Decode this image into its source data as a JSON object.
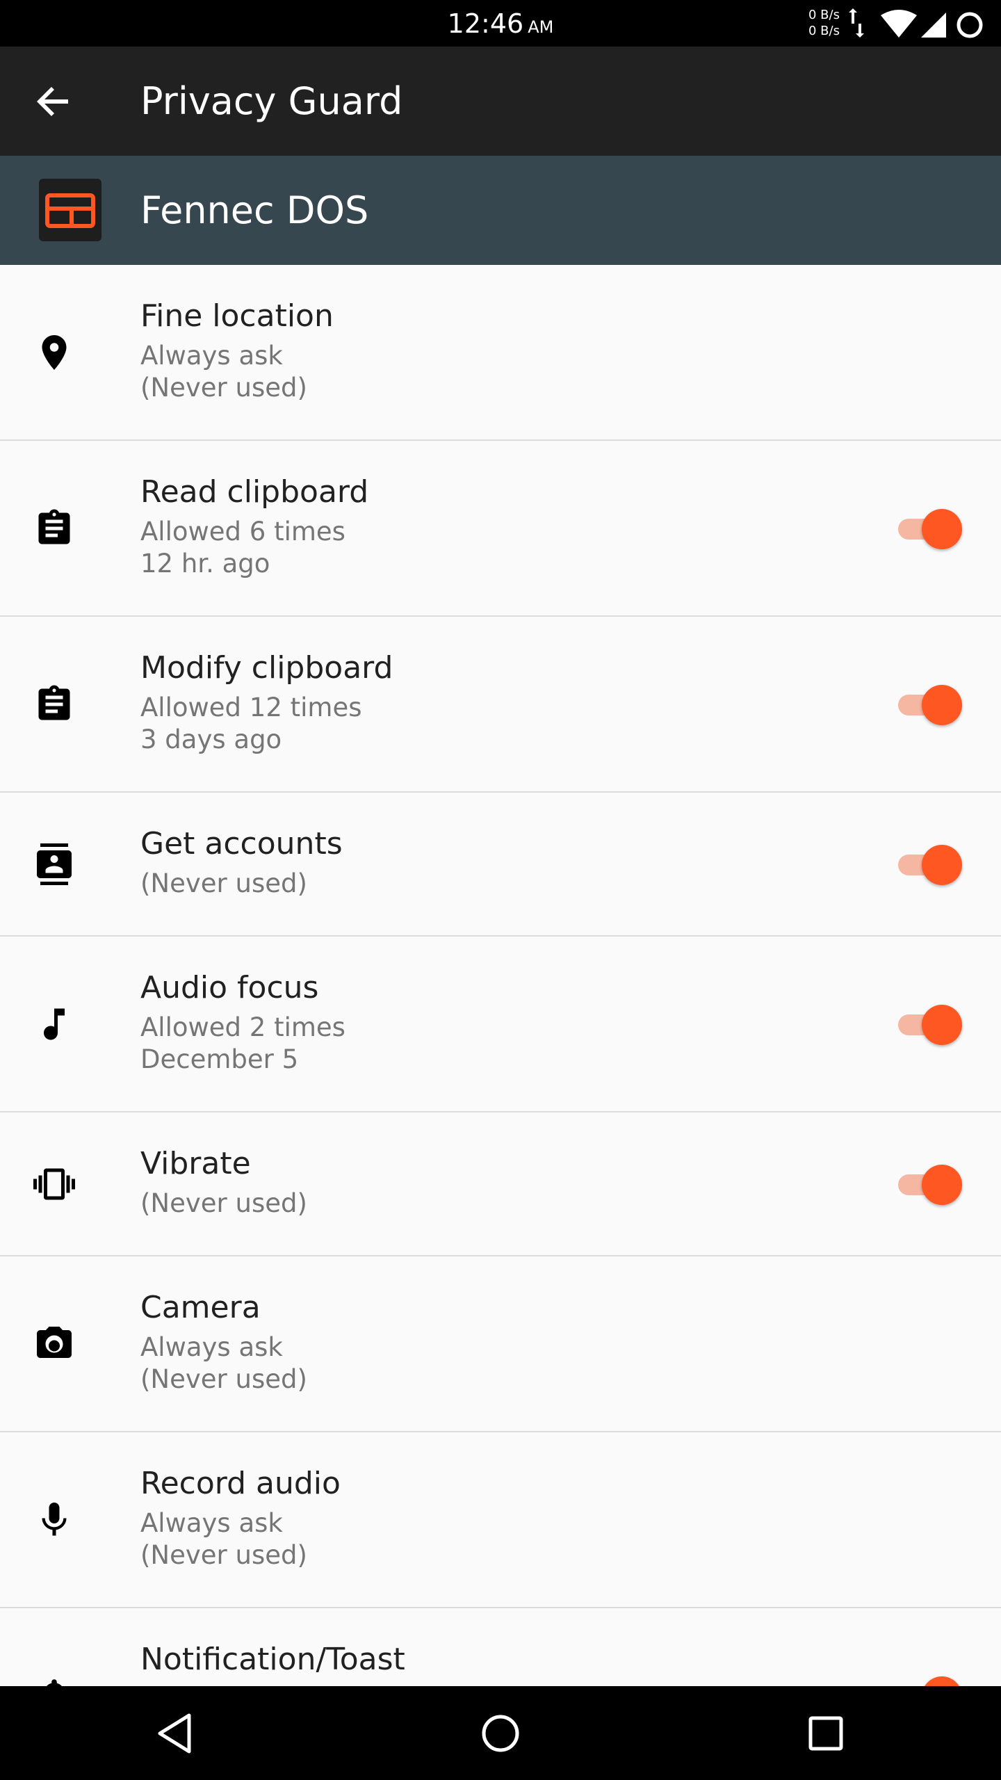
{
  "status_bar": {
    "time": "12:46",
    "ampm": "AM",
    "net_up": "0 B/s",
    "net_down": "0 B/s"
  },
  "toolbar": {
    "title": "Privacy Guard",
    "back_icon": "arrow-back-icon"
  },
  "app": {
    "name": "Fennec DOS",
    "icon": "app-icon"
  },
  "permissions": [
    {
      "title": "Fine location",
      "sub1": "Always ask",
      "sub2": "(Never used)",
      "icon": "location-pin-icon",
      "toggle": null
    },
    {
      "title": "Read clipboard",
      "sub1": "Allowed 6 times",
      "sub2": "12 hr. ago",
      "icon": "clipboard-icon",
      "toggle": true
    },
    {
      "title": "Modify clipboard",
      "sub1": "Allowed 12 times",
      "sub2": "3 days ago",
      "icon": "clipboard-icon",
      "toggle": true
    },
    {
      "title": "Get accounts",
      "sub1": "(Never used)",
      "icon": "contacts-icon",
      "toggle": true
    },
    {
      "title": "Audio focus",
      "sub1": "Allowed 2 times",
      "sub2": "December 5",
      "icon": "music-note-icon",
      "toggle": true
    },
    {
      "title": "Vibrate",
      "sub1": "(Never used)",
      "icon": "vibrate-icon",
      "toggle": true
    },
    {
      "title": "Camera",
      "sub1": "Always ask",
      "sub2": "(Never used)",
      "icon": "camera-icon",
      "toggle": null
    },
    {
      "title": "Record audio",
      "sub1": "Always ask",
      "sub2": "(Never used)",
      "icon": "microphone-icon",
      "toggle": null
    },
    {
      "title": "Notification/Toast",
      "icon": "notification-icon",
      "toggle": true
    }
  ],
  "colors": {
    "accent": "#ff5722",
    "toolbar": "#212121",
    "app_header": "#37474f"
  },
  "nav": {
    "back": "nav-back-icon",
    "home": "nav-home-icon",
    "recents": "nav-recents-icon"
  }
}
